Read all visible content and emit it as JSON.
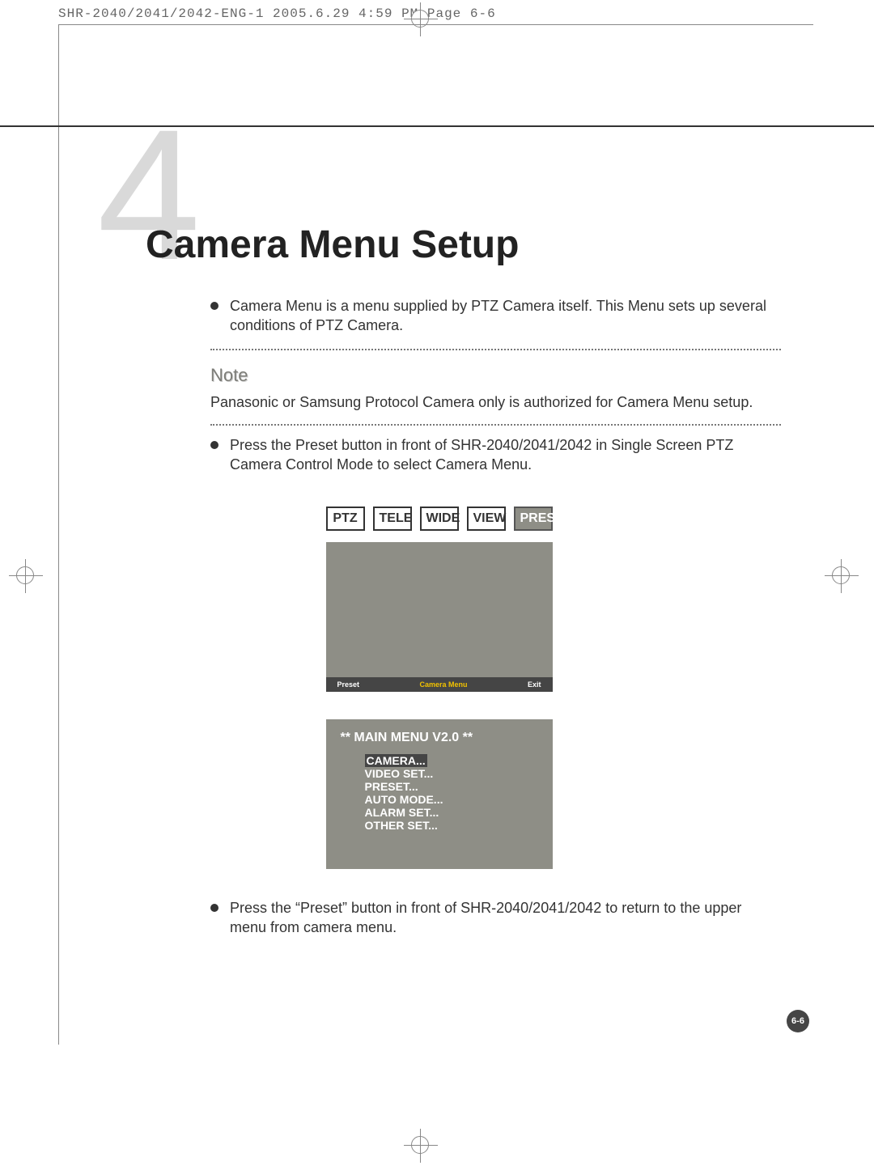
{
  "header_text": "SHR-2040/2041/2042-ENG-1  2005.6.29  4:59 PM  Page 6-6",
  "chapter": {
    "number": "4",
    "title": "Camera Menu Setup"
  },
  "bullets": {
    "b1": "Camera Menu is a menu supplied by PTZ Camera itself. This Menu sets up several conditions of PTZ Camera.",
    "b2": "Press the Preset button in front of SHR-2040/2041/2042 in Single Screen PTZ Camera Control Mode to select Camera Menu.",
    "b3": "Press the “Preset” button in front of SHR-2040/2041/2042 to return to the upper menu from camera menu."
  },
  "note": {
    "title": "Note",
    "text": "Panasonic or Samsung Protocol Camera only is authorized for Camera Menu setup."
  },
  "button_row": {
    "ptz": "PTZ",
    "tele": "TELE",
    "wide": "WIDE",
    "view": "VIEW",
    "preset": "PRESET"
  },
  "screen_footer": {
    "preset": "Preset",
    "camera_menu": "Camera Menu",
    "exit": "Exit"
  },
  "camera_menu_screen": {
    "title": "** MAIN MENU V2.0 **",
    "items": {
      "camera": "CAMERA...",
      "video_set": "VIDEO SET...",
      "preset": "PRESET...",
      "auto_mode": "AUTO MODE...",
      "alarm_set": "ALARM SET...",
      "other_set": "OTHER SET..."
    }
  },
  "page_number": "6-6"
}
